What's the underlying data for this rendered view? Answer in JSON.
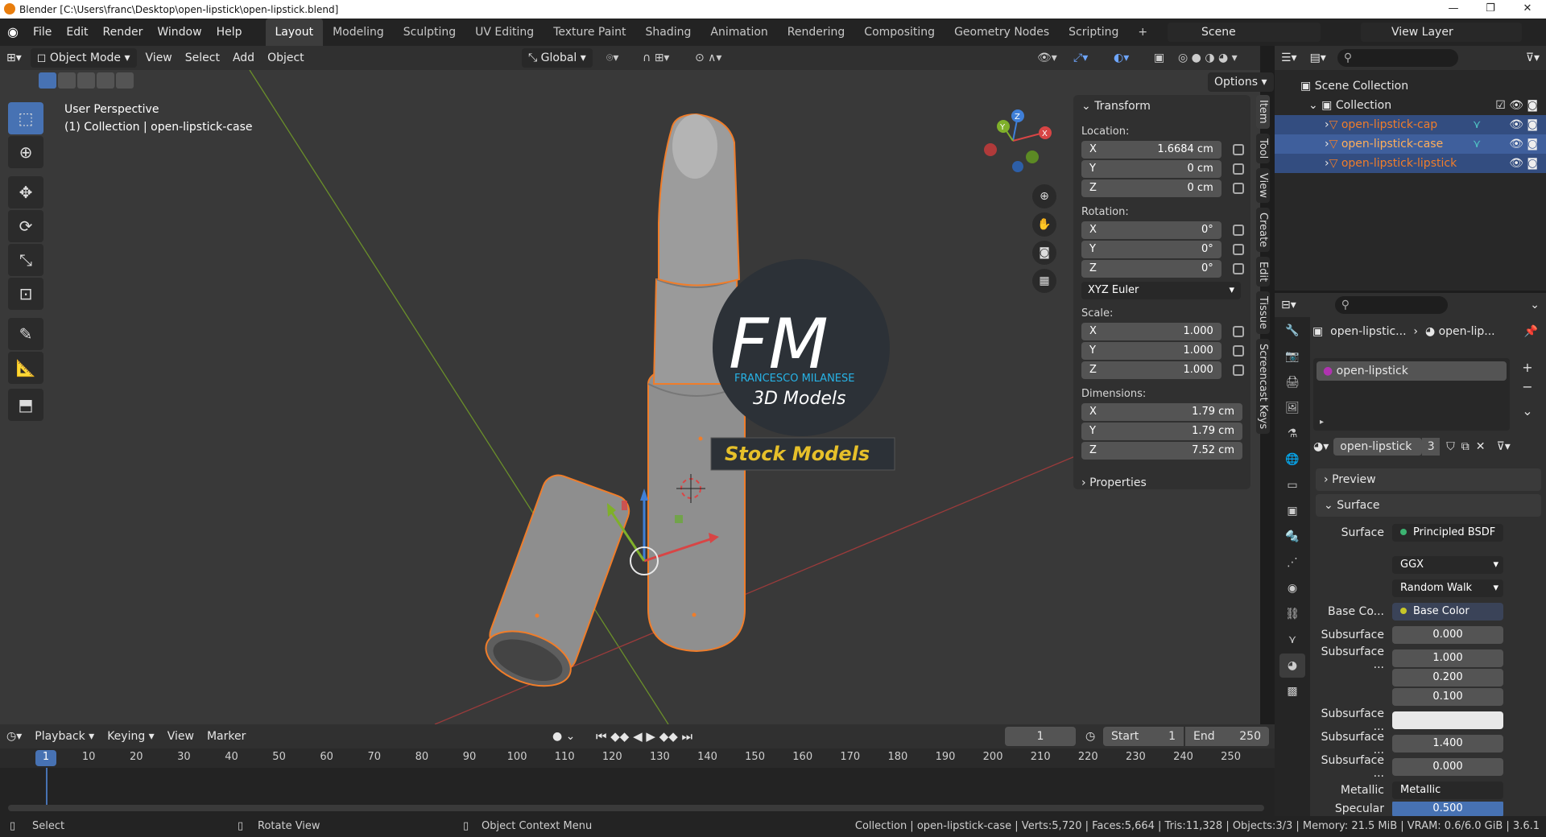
{
  "title_bar": {
    "title": "Blender [C:\\Users\\franc\\Desktop\\open-lipstick\\open-lipstick.blend]"
  },
  "menu": {
    "items": [
      "File",
      "Edit",
      "Render",
      "Window",
      "Help"
    ]
  },
  "workspaces": [
    "Layout",
    "Modeling",
    "Sculpting",
    "UV Editing",
    "Texture Paint",
    "Shading",
    "Animation",
    "Rendering",
    "Compositing",
    "Geometry Nodes",
    "Scripting"
  ],
  "scene": {
    "name": "Scene",
    "view_layer": "View Layer"
  },
  "viewport_header": {
    "mode": "Object Mode",
    "menus": [
      "View",
      "Select",
      "Add",
      "Object"
    ],
    "orientation": "Global",
    "options_label": "Options"
  },
  "viewport": {
    "perspective": "User Perspective",
    "collection_info": "(1) Collection | open-lipstick-case",
    "watermark": {
      "initials": "FM",
      "name": "FRANCESCO MILANESE",
      "sub": "3D Models",
      "banner": "Stock Models"
    }
  },
  "n_panel": {
    "header": "Transform",
    "location_label": "Location:",
    "location": [
      {
        "axis": "X",
        "value": "1.6684 cm"
      },
      {
        "axis": "Y",
        "value": "0 cm"
      },
      {
        "axis": "Z",
        "value": "0 cm"
      }
    ],
    "rotation_label": "Rotation:",
    "rotation": [
      {
        "axis": "X",
        "value": "0°"
      },
      {
        "axis": "Y",
        "value": "0°"
      },
      {
        "axis": "Z",
        "value": "0°"
      }
    ],
    "rotation_mode": "XYZ Euler",
    "scale_label": "Scale:",
    "scale": [
      {
        "axis": "X",
        "value": "1.000"
      },
      {
        "axis": "Y",
        "value": "1.000"
      },
      {
        "axis": "Z",
        "value": "1.000"
      }
    ],
    "dimensions_label": "Dimensions:",
    "dimensions": [
      {
        "axis": "X",
        "value": "1.79 cm"
      },
      {
        "axis": "Y",
        "value": "1.79 cm"
      },
      {
        "axis": "Z",
        "value": "7.52 cm"
      }
    ],
    "properties_label": "Properties"
  },
  "n_tabs": [
    "Item",
    "Tool",
    "View",
    "Create",
    "Edit",
    "Tissue",
    "Screencast Keys"
  ],
  "outliner": {
    "scene_collection": "Scene Collection",
    "collection": "Collection",
    "objects": [
      "open-lipstick-cap",
      "open-lipstick-case",
      "open-lipstick-lipstick"
    ]
  },
  "properties": {
    "breadcrumb_object": "open-lipstic...",
    "breadcrumb_material": "open-lip...",
    "material_slot": "open-lipstick",
    "material_name": "open-lipstick",
    "material_users": "3",
    "preview_label": "Preview",
    "surface_label": "Surface",
    "rows": [
      {
        "label": "Surface",
        "value": "Principled BSDF",
        "dot": "#3cb371"
      },
      {
        "label": "",
        "value": "GGX"
      },
      {
        "label": "",
        "value": "Random Walk"
      },
      {
        "label": "Base Co...",
        "value": "Base Color",
        "dot": "#c7c729"
      },
      {
        "label": "Subsurface",
        "value": "0.000",
        "dot": "#a1a1a1"
      },
      {
        "label": "Subsurface ...",
        "value": "1.000",
        "dot": "#6363c7"
      },
      {
        "label": "",
        "value": "0.200"
      },
      {
        "label": "",
        "value": "0.100"
      },
      {
        "label": "Subsurface ...",
        "value": "",
        "dot": "#c7c729"
      },
      {
        "label": "Subsurface ...",
        "value": "1.400",
        "dot": "#a1a1a1"
      },
      {
        "label": "Subsurface ...",
        "value": "0.000",
        "dot": "#a1a1a1"
      },
      {
        "label": "Metallic",
        "value": "Metallic",
        "dot": "#a1a1a1"
      },
      {
        "label": "Specular",
        "value": "0.500",
        "dot": "#a1a1a1"
      }
    ]
  },
  "timeline": {
    "menus": [
      "Playback",
      "Keying",
      "View",
      "Marker"
    ],
    "current_frame": "1",
    "start_label": "Start",
    "start": "1",
    "end_label": "End",
    "end": "250",
    "ticks": [
      "1",
      "10",
      "20",
      "30",
      "40",
      "50",
      "60",
      "70",
      "80",
      "90",
      "100",
      "110",
      "120",
      "130",
      "140",
      "150",
      "160",
      "170",
      "180",
      "190",
      "200",
      "210",
      "220",
      "230",
      "240",
      "250"
    ]
  },
  "statusbar": {
    "select": "Select",
    "rotate": "Rotate View",
    "context": "Object Context Menu",
    "stats": "Collection | open-lipstick-case | Verts:5,720 | Faces:5,664 | Tris:11,328 | Objects:3/3 | Memory: 21.5 MiB | VRAM: 0.6/6.0 GiB | 3.6.1"
  }
}
